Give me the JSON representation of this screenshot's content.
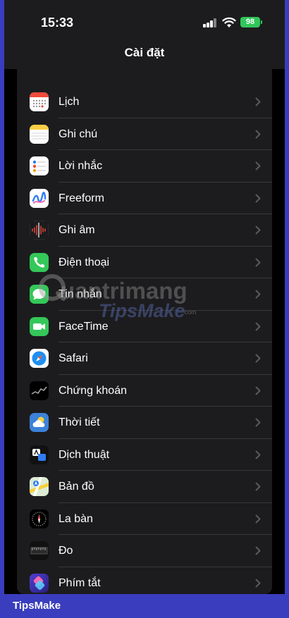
{
  "status_bar": {
    "time": "15:33",
    "battery": "98"
  },
  "nav": {
    "title": "Cài đặt"
  },
  "items": [
    {
      "label": "Lịch",
      "icon": "calendar-icon"
    },
    {
      "label": "Ghi chú",
      "icon": "notes-icon"
    },
    {
      "label": "Lời nhắc",
      "icon": "reminders-icon"
    },
    {
      "label": "Freeform",
      "icon": "freeform-icon"
    },
    {
      "label": "Ghi âm",
      "icon": "voice-memos-icon"
    },
    {
      "label": "Điện thoại",
      "icon": "phone-icon"
    },
    {
      "label": "Tin nhắn",
      "icon": "messages-icon"
    },
    {
      "label": "FaceTime",
      "icon": "facetime-icon"
    },
    {
      "label": "Safari",
      "icon": "safari-icon"
    },
    {
      "label": "Chứng khoán",
      "icon": "stocks-icon"
    },
    {
      "label": "Thời tiết",
      "icon": "weather-icon"
    },
    {
      "label": "Dịch thuật",
      "icon": "translate-icon"
    },
    {
      "label": "Bản đồ",
      "icon": "maps-icon"
    },
    {
      "label": "La bàn",
      "icon": "compass-icon"
    },
    {
      "label": "Đo",
      "icon": "measure-icon"
    },
    {
      "label": "Phím tắt",
      "icon": "shortcuts-icon"
    }
  ],
  "watermark": {
    "line1": "uantrimang",
    "line2": "TipsMake",
    "line3": ".com"
  },
  "footer": {
    "brand": "TipsMake"
  },
  "colors": {
    "background": "#3a3dbd",
    "cell": "#1c1c1e",
    "separator": "#38383a",
    "battery": "#31c65a"
  }
}
